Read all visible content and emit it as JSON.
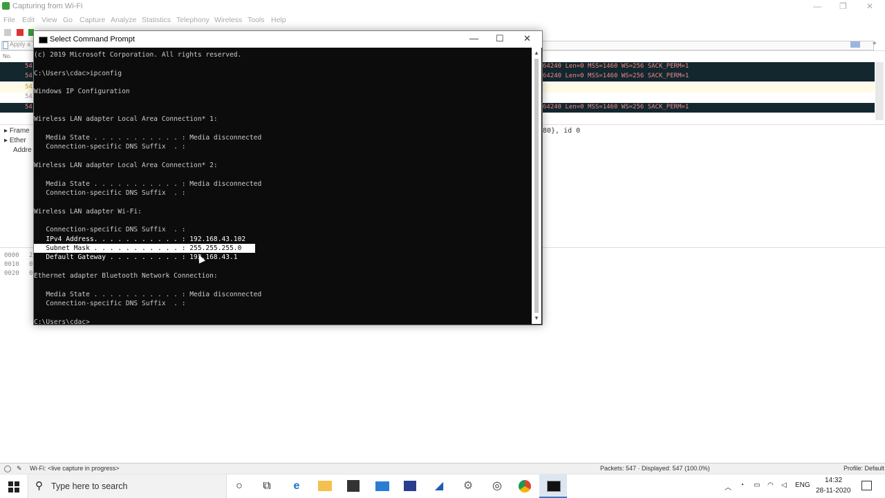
{
  "wireshark": {
    "title": "Capturing from Wi-Fi",
    "menu": [
      "File",
      "Edit",
      "View",
      "Go",
      "Capture",
      "Analyze",
      "Statistics",
      "Telephony",
      "Wireless",
      "Tools",
      "Help"
    ],
    "filter_placeholder": "Apply a",
    "packet_col_no": "No.",
    "packets": [
      {
        "no": "54",
        "info": "64240 Len=0 MSS=1460 WS=256 SACK_PERM=1",
        "style": "dark"
      },
      {
        "no": "54",
        "info": "64240 Len=0 MSS=1460 WS=256 SACK_PERM=1",
        "style": "dark"
      },
      {
        "no": "54",
        "info": "",
        "style": "light"
      },
      {
        "no": "54",
        "info": "",
        "style": "none"
      },
      {
        "no": "54",
        "info": "64240 Len=0 MSS=1460 WS=256 SACK_PERM=1",
        "style": "dark"
      }
    ],
    "details": [
      "Frame",
      "Ether",
      "Addre"
    ],
    "details_right": "80}, id 0",
    "bytes_offsets": [
      "0000",
      "0010",
      "0020"
    ],
    "bytes_marks": [
      "2",
      "0",
      "0"
    ],
    "status_left": "Wi-Fi: <live capture in progress>",
    "status_packets": "Packets: 547 · Displayed: 547 (100.0%)",
    "status_profile": "Profile: Default"
  },
  "cmd": {
    "title": "Select Command Prompt",
    "lines": [
      "(c) 2019 Microsoft Corporation. All rights reserved.",
      "",
      "C:\\Users\\cdac>ipconfig",
      "",
      "Windows IP Configuration",
      "",
      "",
      "Wireless LAN adapter Local Area Connection* 1:",
      "",
      "   Media State . . . . . . . . . . . : Media disconnected",
      "   Connection-specific DNS Suffix  . :",
      "",
      "Wireless LAN adapter Local Area Connection* 2:",
      "",
      "   Media State . . . . . . . . . . . : Media disconnected",
      "   Connection-specific DNS Suffix  . :",
      "",
      "Wireless LAN adapter Wi-Fi:",
      "",
      "   Connection-specific DNS Suffix  . :",
      "   IPv4 Address. . . . . . . . . . . : 192.168.43.102",
      "   Subnet Mask . . . . . . . . . . . : 255.255.255.0",
      "   Default Gateway . . . . . . . . . : 192.168.43.1",
      "",
      "Ethernet adapter Bluetooth Network Connection:",
      "",
      "   Media State . . . . . . . . . . . : Media disconnected",
      "   Connection-specific DNS Suffix  . :",
      "",
      "C:\\Users\\cdac>"
    ]
  },
  "taskbar": {
    "search_placeholder": "Type here to search",
    "lang": "ENG",
    "time": "14:32",
    "date": "28-11-2020"
  }
}
